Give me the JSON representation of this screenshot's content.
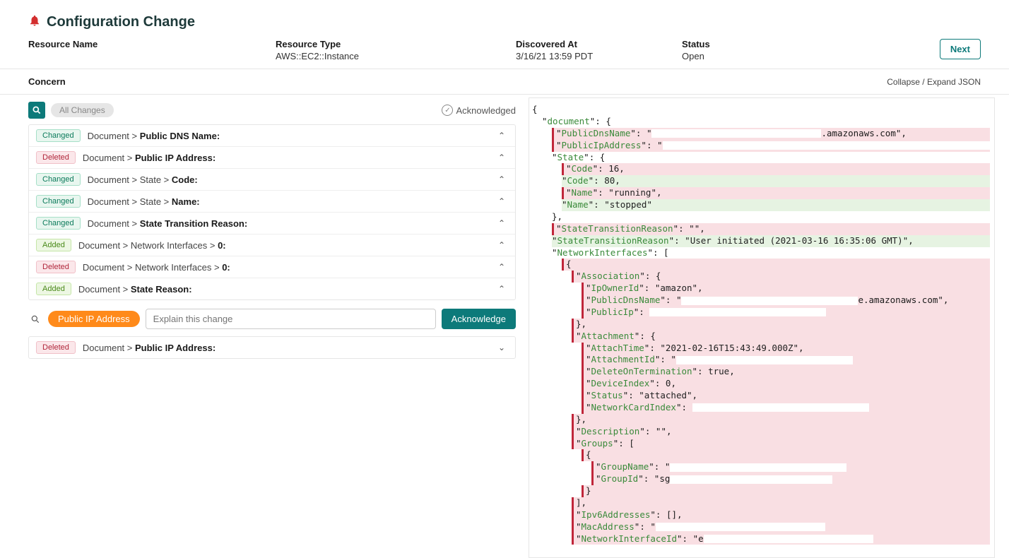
{
  "header": {
    "title": "Configuration Change",
    "resource_name_label": "Resource Name",
    "resource_name_value": "",
    "resource_type_label": "Resource Type",
    "resource_type_value": "AWS::EC2::Instance",
    "discovered_label": "Discovered At",
    "discovered_value": "3/16/21 13:59 PDT",
    "status_label": "Status",
    "status_value": "Open",
    "next_label": "Next"
  },
  "concern": {
    "label": "Concern",
    "collapse": "Collapse",
    "expand": "Expand JSON"
  },
  "filter": {
    "all_changes": "All Changes",
    "acknowledged": "Acknowledged"
  },
  "changes": [
    {
      "badge": "Changed",
      "badgeClass": "badge-changed",
      "path": "Document > ",
      "last": "Public DNS Name:"
    },
    {
      "badge": "Deleted",
      "badgeClass": "badge-deleted",
      "path": "Document > ",
      "last": "Public IP Address:"
    },
    {
      "badge": "Changed",
      "badgeClass": "badge-changed",
      "path": "Document > State > ",
      "last": "Code:"
    },
    {
      "badge": "Changed",
      "badgeClass": "badge-changed",
      "path": "Document > State > ",
      "last": "Name:"
    },
    {
      "badge": "Changed",
      "badgeClass": "badge-changed",
      "path": "Document > ",
      "last": "State Transition Reason:"
    },
    {
      "badge": "Added",
      "badgeClass": "badge-added",
      "path": "Document > Network Interfaces > ",
      "last": "0:"
    },
    {
      "badge": "Deleted",
      "badgeClass": "badge-deleted",
      "path": "Document > Network Interfaces > ",
      "last": "0:"
    },
    {
      "badge": "Added",
      "badgeClass": "badge-added",
      "path": "Document > ",
      "last": "State Reason:"
    }
  ],
  "action": {
    "chip": "Public IP Address",
    "placeholder": "Explain this change",
    "acknowledge": "Acknowledge"
  },
  "selected_change": {
    "badge": "Deleted",
    "badgeClass": "badge-deleted",
    "path": "Document > ",
    "last": "Public IP Address:"
  },
  "json": {
    "document_key": "document",
    "PublicDnsName": "PublicDnsName",
    "PublicDnsName_suffix": ".amazonaws.com",
    "PublicIpAddress": "PublicIpAddress",
    "State": "State",
    "Code": "Code",
    "Code_old": "16",
    "Code_new": "80",
    "Name": "Name",
    "Name_old": "running",
    "Name_new": "stopped",
    "StateTransitionReason": "StateTransitionReason",
    "STR_old": "",
    "STR_new": "User initiated (2021-03-16 16:35:06 GMT)",
    "NetworkInterfaces": "NetworkInterfaces",
    "Association": "Association",
    "IpOwnerId": "IpOwnerId",
    "IpOwnerId_val": "amazon",
    "PublicDnsName2": "PublicDnsName",
    "PublicDnsName2_suffix": "e.amazonaws.com",
    "PublicIp": "PublicIp",
    "Attachment": "Attachment",
    "AttachTime": "AttachTime",
    "AttachTime_val": "2021-02-16T15:43:49.000Z",
    "AttachmentId": "AttachmentId",
    "DeleteOnTermination": "DeleteOnTermination",
    "DeleteOnTermination_val": "true",
    "DeviceIndex": "DeviceIndex",
    "DeviceIndex_val": "0",
    "Status": "Status",
    "Status_val": "attached",
    "NetworkCardIndex": "NetworkCardIndex",
    "Description": "Description",
    "Description_val": "",
    "Groups": "Groups",
    "GroupName": "GroupName",
    "GroupId": "GroupId",
    "GroupId_prefix": "sg",
    "Ipv6Addresses": "Ipv6Addresses",
    "MacAddress": "MacAddress",
    "NetworkInterfaceId": "NetworkInterfaceId",
    "NetworkInterfaceId_prefix": "e"
  }
}
